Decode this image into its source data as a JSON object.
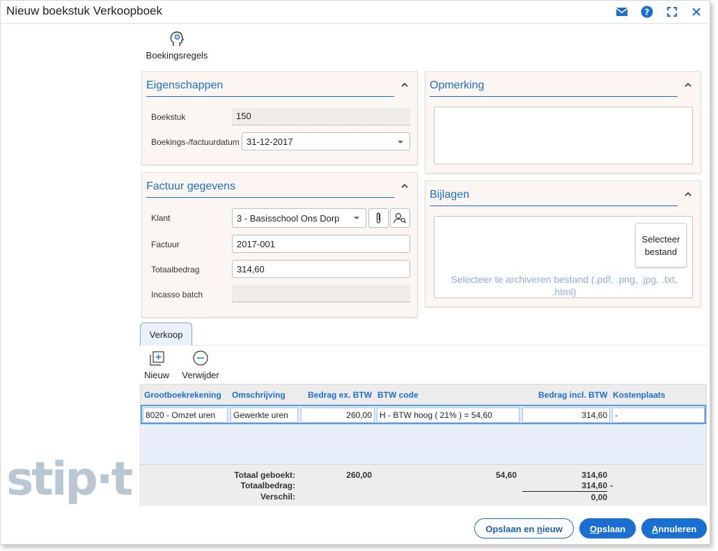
{
  "window": {
    "title": "Nieuw boekstuk Verkoopboek"
  },
  "toolbar": {
    "boekingsregels_label": "Boekingsregels"
  },
  "logo_text": "stip·t",
  "eigenschappen": {
    "title": "Eigenschappen",
    "boekstuk_label": "Boekstuk",
    "boekstuk_value": "150",
    "datum_label": "Boekings-/factuurdatum",
    "datum_value": "31-12-2017"
  },
  "factuur": {
    "title": "Factuur gegevens",
    "klant_label": "Klant",
    "klant_value": "3 - Basisschool Ons Dorp",
    "factuur_label": "Factuur",
    "factuur_value": "2017-001",
    "totaal_label": "Totaalbedrag",
    "totaal_value": "314,60",
    "incasso_label": "Incasso batch",
    "incasso_value": ""
  },
  "opmerking": {
    "title": "Opmerking",
    "value": ""
  },
  "bijlagen": {
    "title": "Bijlagen",
    "select_line1": "Selecteer",
    "select_line2": "bestand",
    "hint_line1": "Selecteer te archiveren bestand (.pdf, .png, .jpg, .txt,",
    "hint_line2": ".html)"
  },
  "tabs": [
    {
      "label": "Verkoop"
    }
  ],
  "grid_actions": {
    "new_label": "Nieuw",
    "delete_label": "Verwijder"
  },
  "grid": {
    "columns": [
      "Grootboekrekening",
      "Omschrijving",
      "Bedrag ex. BTW",
      "BTW code",
      "Bedrag incl. BTW",
      "Kostenplaats"
    ],
    "rows": [
      {
        "account": "8020 - Omzet uren",
        "description": "Gewerkte uren",
        "amount_ex": "260,00",
        "vat_code": "H - BTW hoog ( 21% ) = 54,60",
        "amount_incl": "314,60",
        "cost_center": "-"
      }
    ],
    "footer": {
      "totaal_geboekt_label": "Totaal geboekt:",
      "totaalbedrag_label": "Totaalbedrag:",
      "verschil_label": "Verschil:",
      "geboekt_ex": "260,00",
      "geboekt_btw": "54,60",
      "geboekt_incl": "314,60",
      "totaalbedrag_value": "314,60",
      "totaalbedrag_suffix": "-",
      "verschil_value": "0,00"
    }
  },
  "buttons": {
    "save_new_prefix": "Opslaan en ",
    "save_new_underlined": "n",
    "save_new_suffix": "ieuw",
    "save_underlined": "O",
    "save_rest": "pslaan",
    "cancel_underlined": "A",
    "cancel_rest": "nnuleren"
  },
  "colors": {
    "accent": "#1b6fd1",
    "panel_bg": "#fbf6f1",
    "grid_row_bg": "#e7effa"
  }
}
